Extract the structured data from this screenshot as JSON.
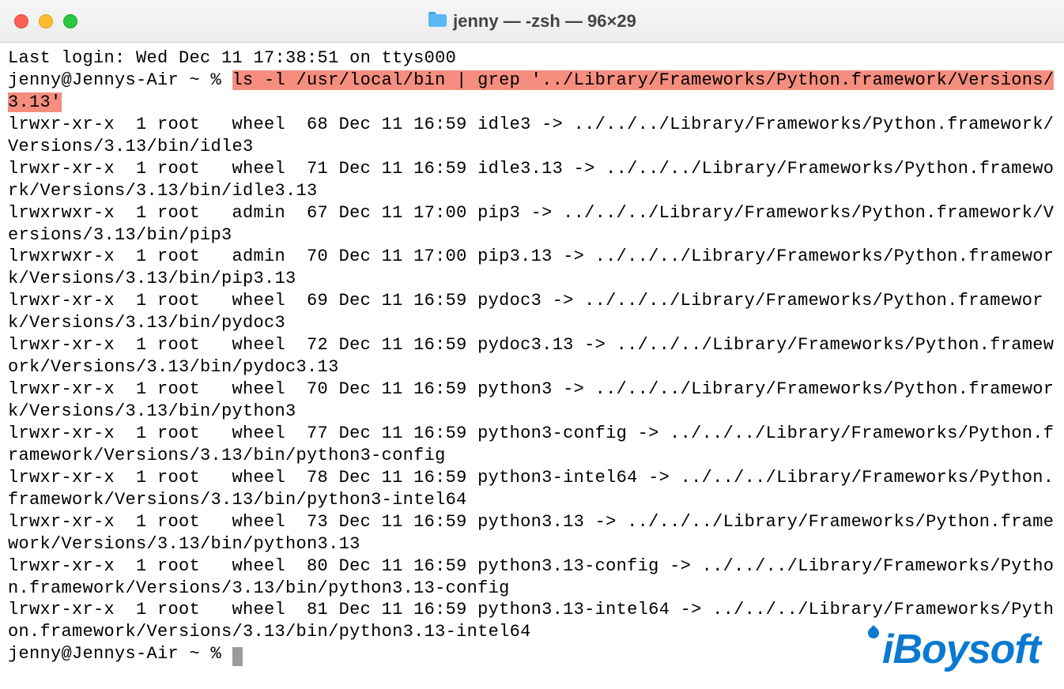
{
  "window": {
    "title": "jenny — -zsh — 96×29"
  },
  "terminal": {
    "last_login": "Last login: Wed Dec 11 17:38:51 on ttys000",
    "prompt1_prefix": "jenny@Jennys-Air ~ % ",
    "cmd_highlight": "ls -l /usr/local/bin | grep '../Library/Frameworks/Python.framework/Versions/3.13'",
    "listing": [
      "lrwxr-xr-x  1 root   wheel  68 Dec 11 16:59 idle3 -> ../../../Library/Frameworks/Python.framework/Versions/3.13/bin/idle3",
      "lrwxr-xr-x  1 root   wheel  71 Dec 11 16:59 idle3.13 -> ../../../Library/Frameworks/Python.framework/Versions/3.13/bin/idle3.13",
      "lrwxrwxr-x  1 root   admin  67 Dec 11 17:00 pip3 -> ../../../Library/Frameworks/Python.framework/Versions/3.13/bin/pip3",
      "lrwxrwxr-x  1 root   admin  70 Dec 11 17:00 pip3.13 -> ../../../Library/Frameworks/Python.framework/Versions/3.13/bin/pip3.13",
      "lrwxr-xr-x  1 root   wheel  69 Dec 11 16:59 pydoc3 -> ../../../Library/Frameworks/Python.framework/Versions/3.13/bin/pydoc3",
      "lrwxr-xr-x  1 root   wheel  72 Dec 11 16:59 pydoc3.13 -> ../../../Library/Frameworks/Python.framework/Versions/3.13/bin/pydoc3.13",
      "lrwxr-xr-x  1 root   wheel  70 Dec 11 16:59 python3 -> ../../../Library/Frameworks/Python.framework/Versions/3.13/bin/python3",
      "lrwxr-xr-x  1 root   wheel  77 Dec 11 16:59 python3-config -> ../../../Library/Frameworks/Python.framework/Versions/3.13/bin/python3-config",
      "lrwxr-xr-x  1 root   wheel  78 Dec 11 16:59 python3-intel64 -> ../../../Library/Frameworks/Python.framework/Versions/3.13/bin/python3-intel64",
      "lrwxr-xr-x  1 root   wheel  73 Dec 11 16:59 python3.13 -> ../../../Library/Frameworks/Python.framework/Versions/3.13/bin/python3.13",
      "lrwxr-xr-x  1 root   wheel  80 Dec 11 16:59 python3.13-config -> ../../../Library/Frameworks/Python.framework/Versions/3.13/bin/python3.13-config",
      "lrwxr-xr-x  1 root   wheel  81 Dec 11 16:59 python3.13-intel64 -> ../../../Library/Frameworks/Python.framework/Versions/3.13/bin/python3.13-intel64"
    ],
    "prompt2": "jenny@Jennys-Air ~ % "
  },
  "watermark": "iBoysoft"
}
